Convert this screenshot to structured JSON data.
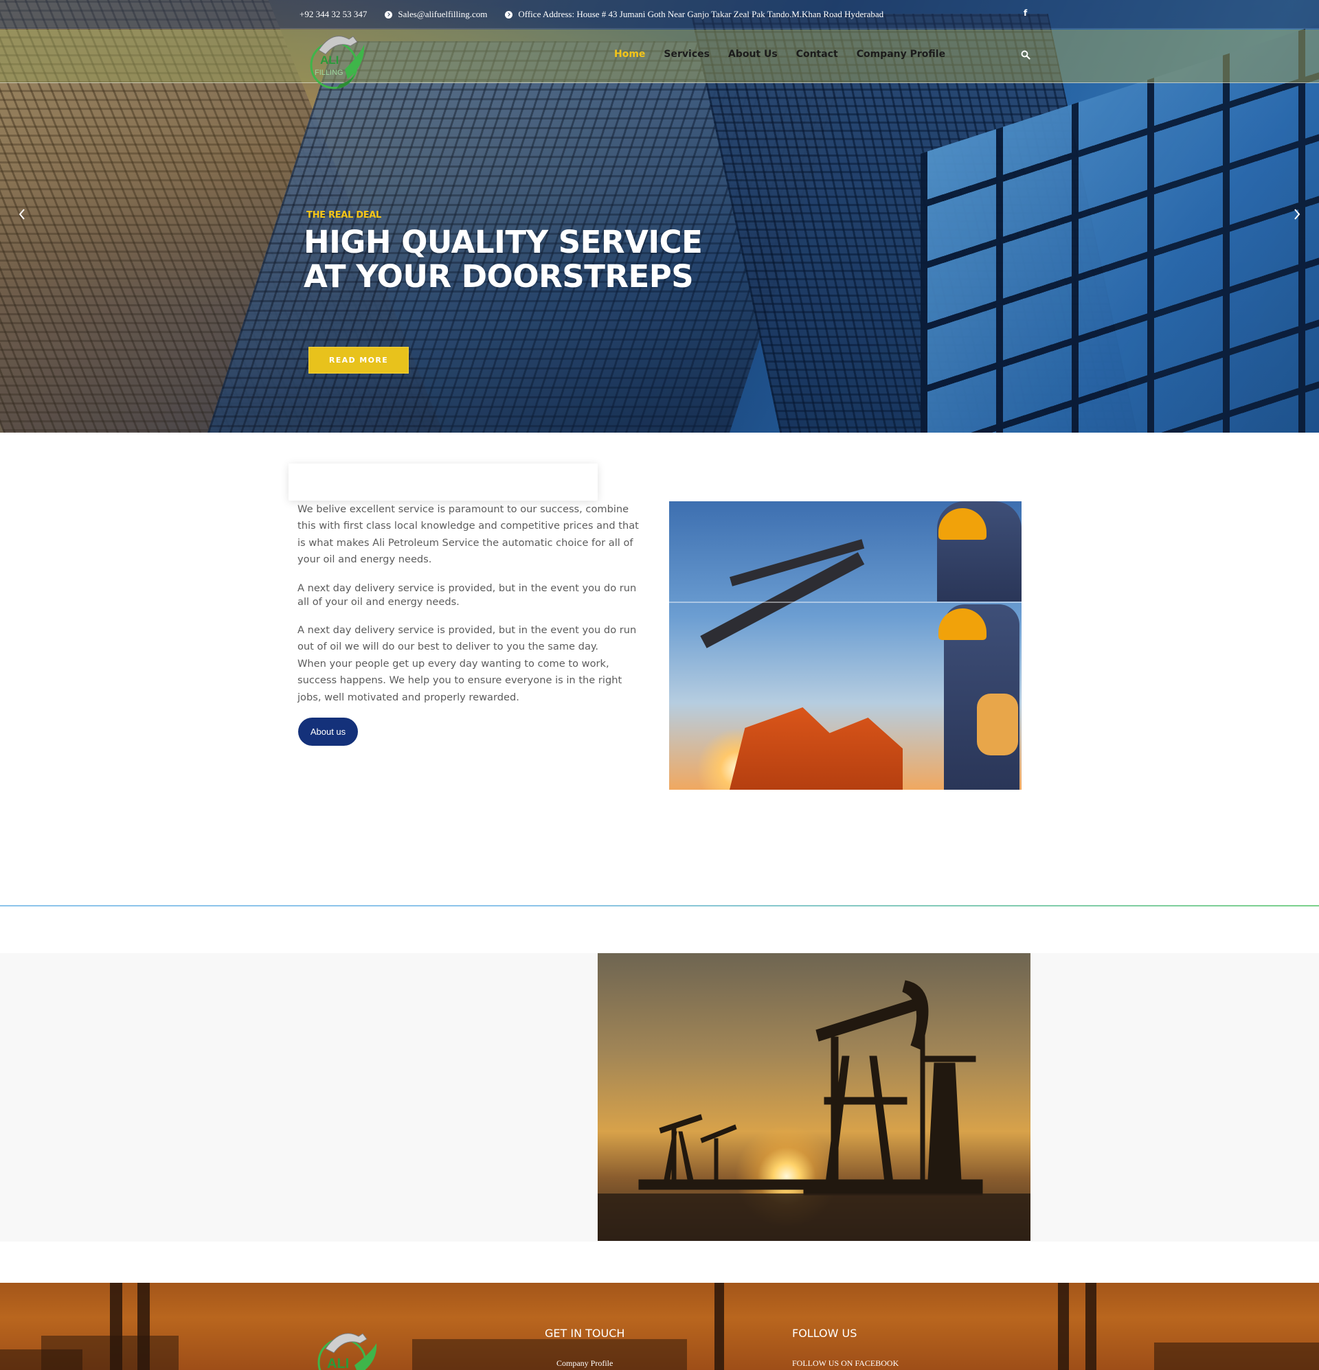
{
  "topbar": {
    "phone": "+92 344 32 53 347",
    "email": "Sales@alifuelfilling.com",
    "address": "Office Address: House # 43 Jumani Goth Near Ganjo Takar Zeal Pak Tando.M.Khan Road Hyderabad",
    "facebook_icon": "f"
  },
  "brand": {
    "logo_text_1": "ALI",
    "logo_text_2": "FILLING"
  },
  "nav": {
    "items": [
      {
        "label": "Home",
        "active": true
      },
      {
        "label": "Services",
        "active": false
      },
      {
        "label": "About Us",
        "active": false
      },
      {
        "label": "Contact",
        "active": false
      },
      {
        "label": "Company Profile",
        "active": false
      }
    ]
  },
  "hero": {
    "eyebrow": "THE REAL DEAL",
    "title_line1": "HIGH QUALITY SERVICE",
    "title_line2": "AT YOUR DOORSTREPS",
    "button": "READ MORE"
  },
  "about": {
    "p1": "We belive excellent service is paramount to our success, combine this with first class local knowledge and competitive prices and that is what makes Ali Petroleum Service the automatic choice for all of your oil and energy needs.",
    "p2a": "A next day delivery service is provided, but in the event you do run out of oil we will do our best to deliver to you the same day.",
    "p2b": "all of your oil and energy needs.",
    "p3": "A next day delivery service is provided, but in the event you do run out of oil we will do our best to deliver to you the same day.",
    "p4": "When your people get up every day wanting to come to work, success happens. We help you to ensure everyone is in the right jobs, well motivated and properly rewarded.",
    "button": "About us"
  },
  "footer": {
    "get_in_touch": "GET IN TOUCH",
    "company_profile": "Company Profile",
    "follow_us": "FOLLOW US",
    "follow_facebook": "FOLLOW US ON FACEBOOK"
  },
  "colors": {
    "accent_yellow": "#f5c518",
    "button_navy": "#14317a",
    "footer_orange": "#b9661e"
  },
  "icons": [
    "location-arrow-icon",
    "facebook-icon",
    "search-icon",
    "chevron-left-icon",
    "chevron-right-icon"
  ]
}
